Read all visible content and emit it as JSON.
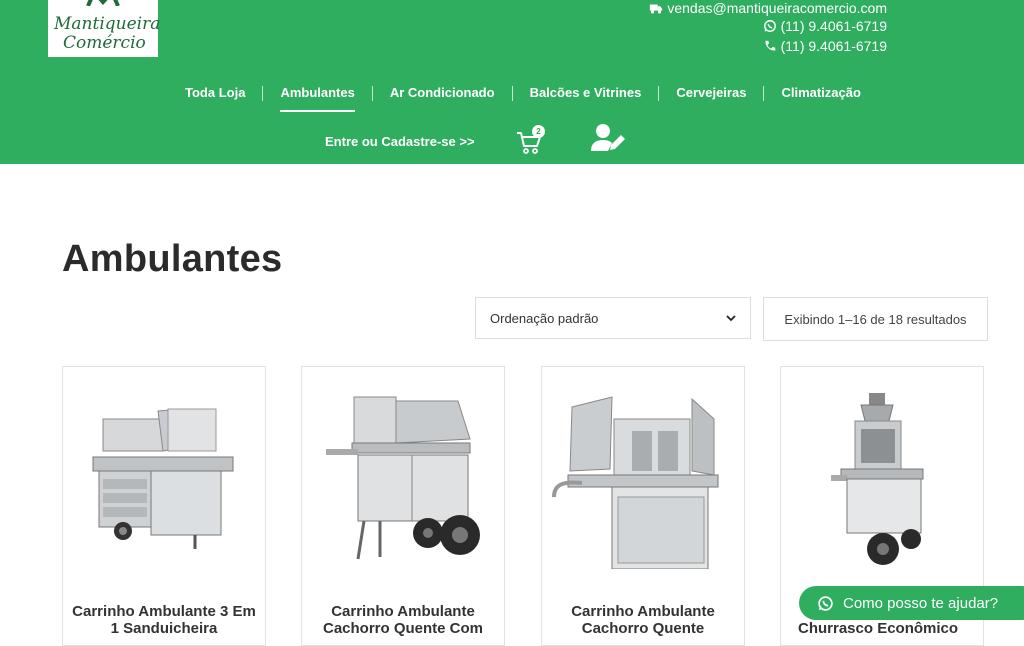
{
  "logo": {
    "line1": "Mantiqueira",
    "line2": "Comércio"
  },
  "contact": {
    "email": "vendas@mantiqueiracomercio.com",
    "whatsapp": "(11) 9.4061-6719",
    "phone": "(11) 9.4061-6719"
  },
  "nav": {
    "items": [
      {
        "label": "Toda Loja"
      },
      {
        "label": "Ambulantes"
      },
      {
        "label": "Ar Condicionado"
      },
      {
        "label": "Balcões e Vitrines"
      },
      {
        "label": "Cervejeiras"
      },
      {
        "label": "Climatização"
      }
    ]
  },
  "account": {
    "login_label": "Entre ou Cadastre-se >>",
    "cart_count": "2"
  },
  "page": {
    "title": "Ambulantes"
  },
  "toolbar": {
    "sort_label": "Ordenação padrão",
    "result_count": "Exibindo 1–16 de 18 resultados"
  },
  "products": [
    {
      "title": "Carrinho Ambulante 3 Em 1 Sanduicheira"
    },
    {
      "title": "Carrinho Ambulante Cachorro Quente Com"
    },
    {
      "title": "Carrinho Ambulante Cachorro Quente"
    },
    {
      "title": "Churrasco Econômico"
    }
  ],
  "chat": {
    "label": "Como posso te ajudar?"
  },
  "colors": {
    "brand_green": "#2eae5e",
    "title_dark": "#2b2b2b"
  }
}
